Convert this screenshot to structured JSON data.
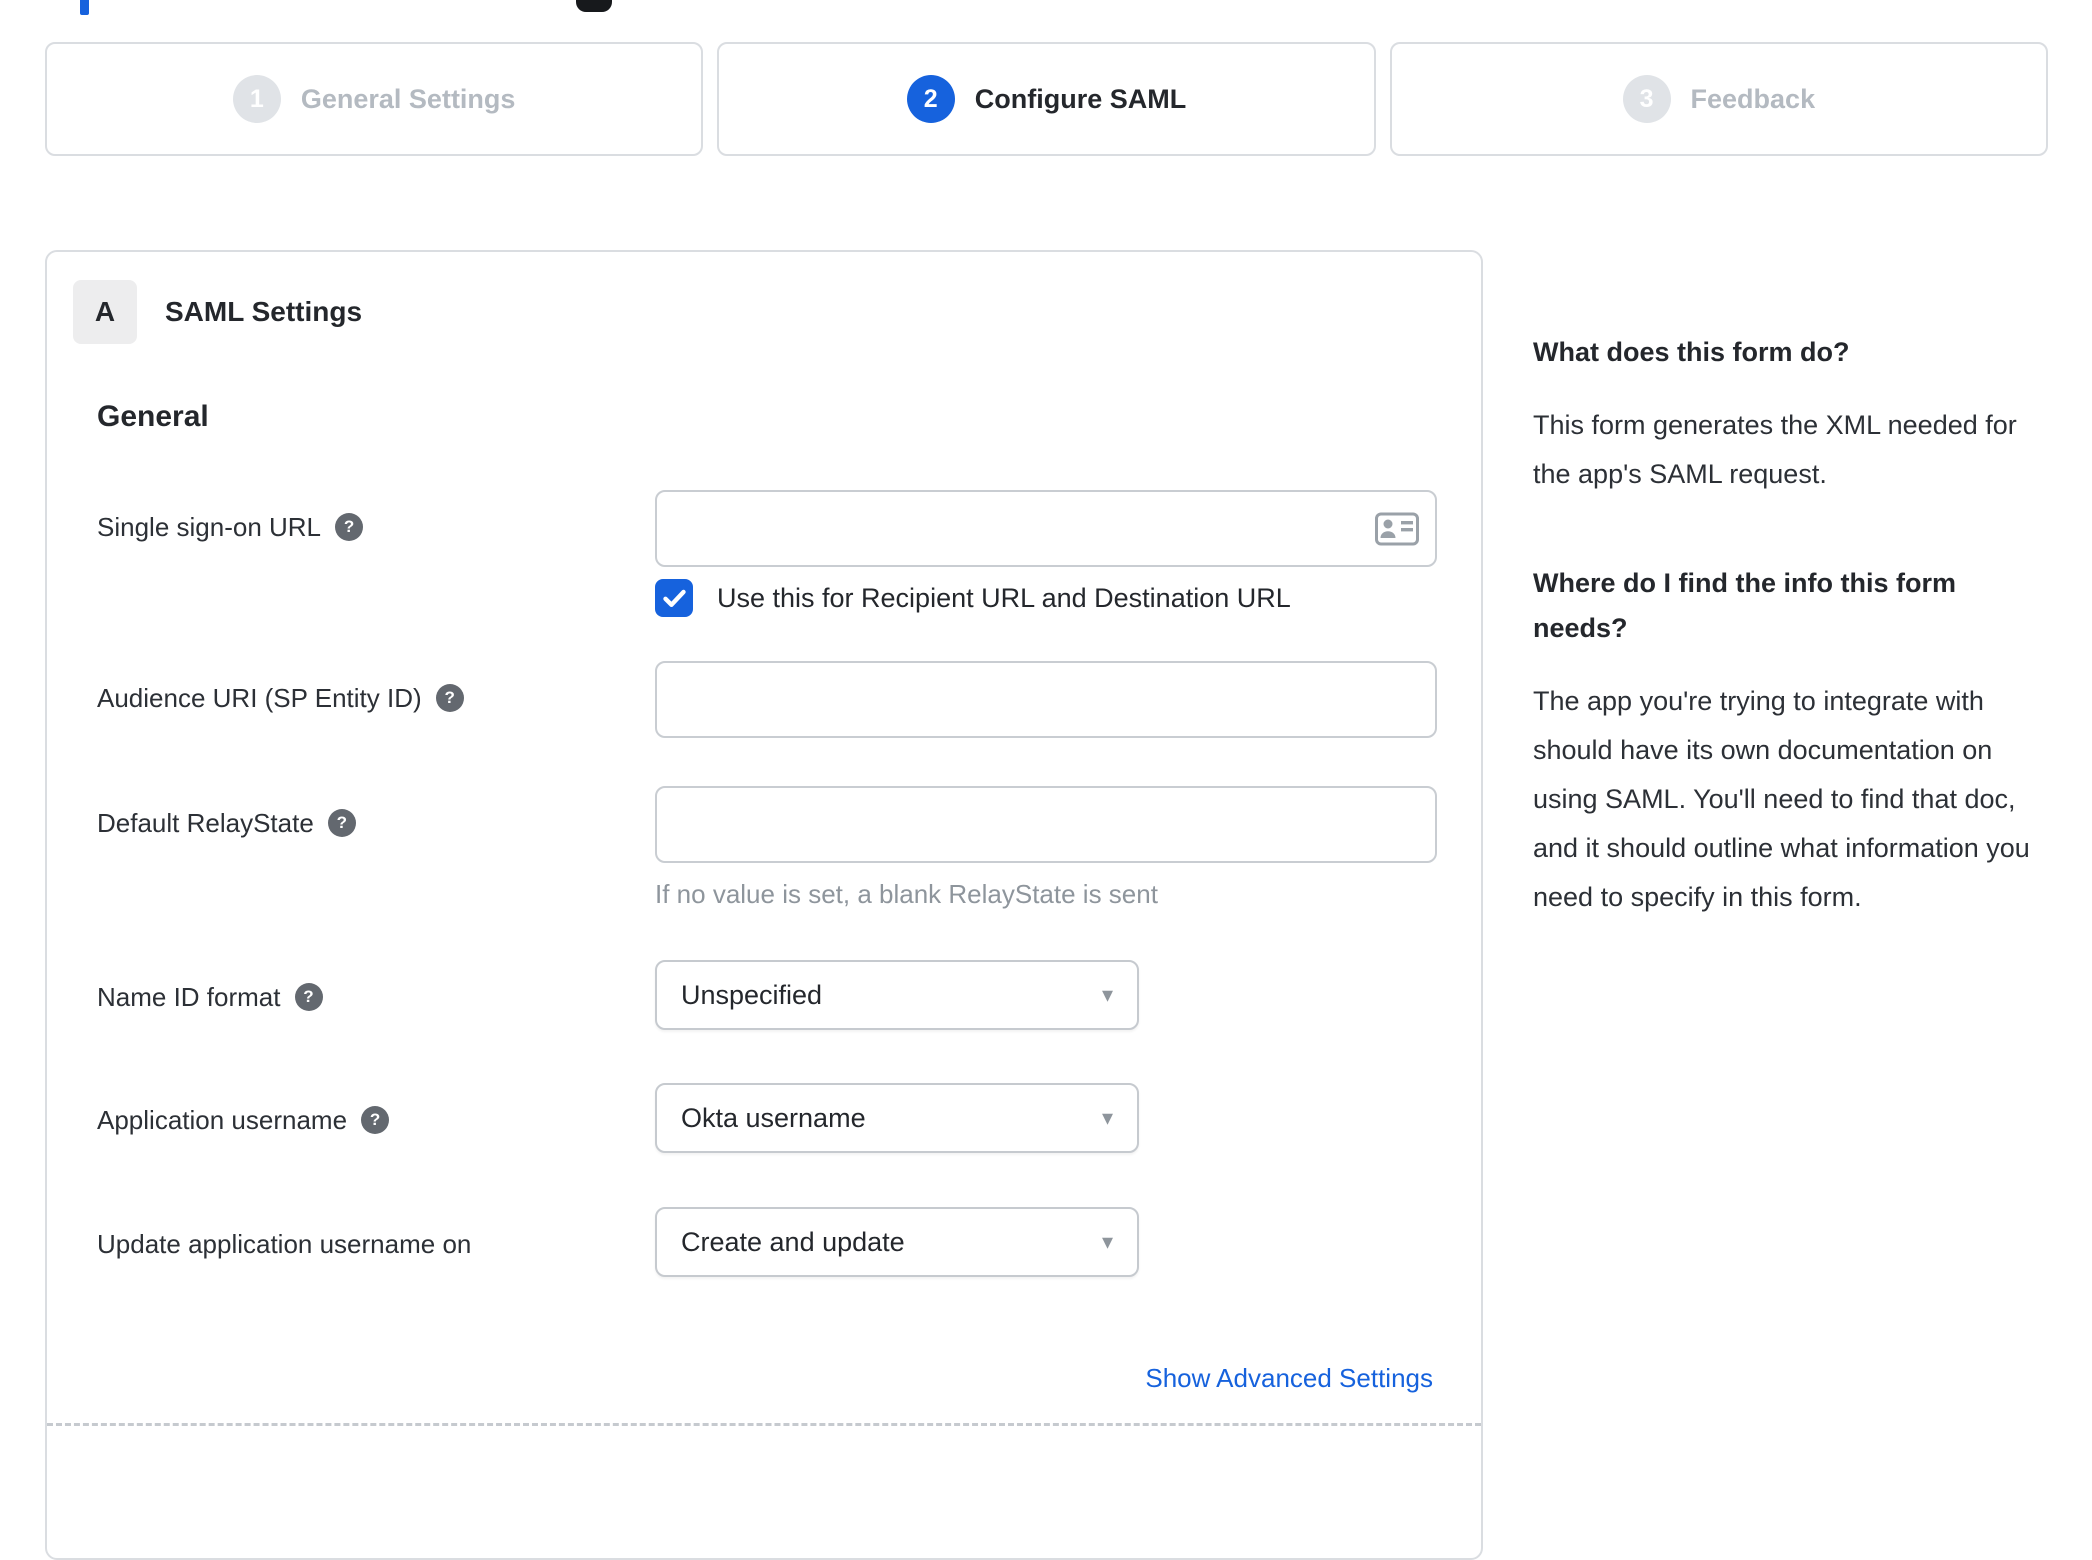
{
  "colors": {
    "accent_blue": "#1662dd",
    "link_blue": "#1662dd",
    "inactive_step_gray": "#b4bac1",
    "border_gray": "#dadde1",
    "text_dark": "#24272c",
    "hint_gray": "#8e959c"
  },
  "icons": {
    "help": "?",
    "caret": "▾"
  },
  "stepper": {
    "steps": [
      {
        "number": "1",
        "label": "General Settings",
        "active": false
      },
      {
        "number": "2",
        "label": "Configure SAML",
        "active": true
      },
      {
        "number": "3",
        "label": "Feedback",
        "active": false
      }
    ]
  },
  "panel": {
    "badge": "A",
    "title": "SAML Settings",
    "section": "General",
    "fields": [
      {
        "label": "Single sign-on URL",
        "value": "",
        "checkbox_label": "Use this for Recipient URL and Destination URL",
        "checkbox_checked": true
      },
      {
        "label": "Audience URI (SP Entity ID)",
        "value": ""
      },
      {
        "label": "Default RelayState",
        "value": "",
        "hint": "If no value is set, a blank RelayState is sent"
      },
      {
        "label": "Name ID format",
        "value": "Unspecified"
      },
      {
        "label": "Application username",
        "value": "Okta username"
      },
      {
        "label": "Update application username on",
        "value": "Create and update"
      }
    ],
    "advanced_link": "Show Advanced Settings"
  },
  "help_panel": {
    "sections": [
      {
        "heading": "What does this form do?",
        "body": "This form generates the XML needed for the app's SAML request."
      },
      {
        "heading": "Where do I find the info this form needs?",
        "body": "The app you're trying to integrate with should have its own documentation on using SAML. You'll need to find that doc, and it should outline what information you need to specify in this form."
      }
    ]
  }
}
